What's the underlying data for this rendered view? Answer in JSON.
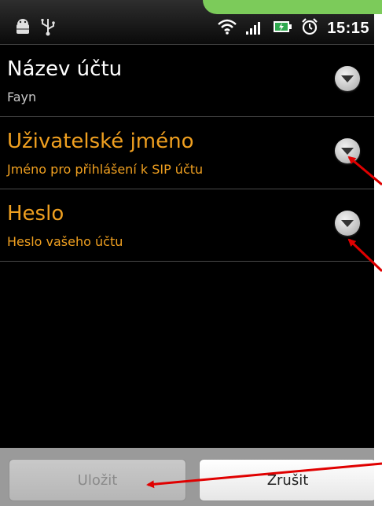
{
  "status_bar": {
    "time": "15:15",
    "icons_left": [
      "android-debug-icon",
      "usb-icon"
    ],
    "icons_right": [
      "wifi-icon",
      "signal-icon",
      "battery-charging-icon",
      "alarm-clock-icon"
    ]
  },
  "settings": [
    {
      "title": "Název účtu",
      "subtitle": "Fayn",
      "highlighted": false
    },
    {
      "title": "Uživatelské jméno",
      "subtitle": "Jméno pro přihlášení k SIP účtu",
      "highlighted": true
    },
    {
      "title": "Heslo",
      "subtitle": "Heslo vašeho účtu",
      "highlighted": true
    }
  ],
  "buttons": {
    "save_label": "Uložit",
    "cancel_label": "Zrušit"
  },
  "colors": {
    "accent": "#f0a020",
    "annotation_arrow": "#e00000"
  }
}
